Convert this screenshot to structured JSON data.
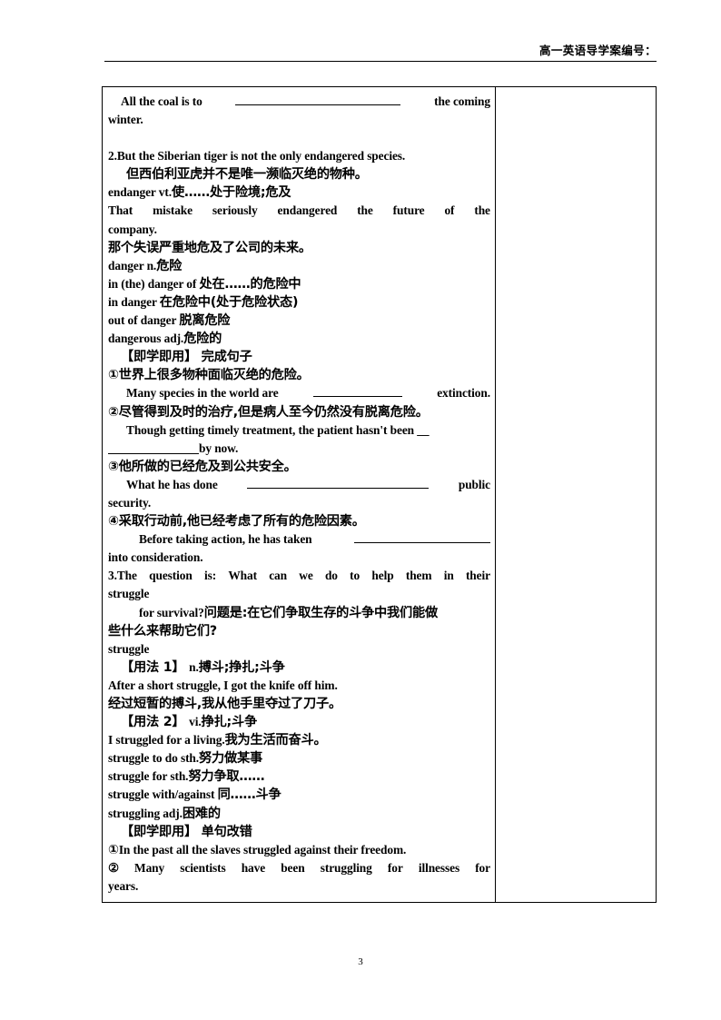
{
  "header": {
    "title": "高一英语导学案编号："
  },
  "page": {
    "number": "3"
  },
  "content": {
    "l1a": "All  the  coal  is  to",
    "l1b": "the  coming",
    "l2": "winter.",
    "l3": "2.But the Siberian tiger is not the only endangered species.",
    "l4": "但西伯利亚虎并不是唯一濒临灭绝的物种。",
    "l5_en": "endanger vt.",
    "l5_cn": "使……处于险境;危及",
    "l6a": "That",
    "l6b": "mistake",
    "l6c": "seriously",
    "l6d": "endangered",
    "l6e": "the",
    "l6f": "future",
    "l6g": "of",
    "l6h": "the",
    "l7": "company.",
    "l8": "那个失误严重地危及了公司的未来。",
    "l9_en": "danger n.",
    "l9_cn": "危险",
    "l10_en": "in (the) danger of ",
    "l10_cn": "处在……的危险中",
    "l11_en": "in danger  ",
    "l11_cn": "在危险中(处于危险状态)",
    "l12_en": "out of danger  ",
    "l12_cn": "脱离危险",
    "l13_en": "dangerous adj.",
    "l13_cn": "危险的",
    "l14": "【即学即用】 完成句子",
    "l15": "①世界上很多物种面临灭绝的危险。",
    "l16a": "Many species in the world are",
    "l16b": "extinction.",
    "l17": "②尽管得到及时的治疗,但是病人至今仍然没有脱离危险。",
    "l18": "Though getting timely treatment, the patient hasn't been __",
    "l19": "by now.",
    "l20": "③他所做的已经危及到公共安全。",
    "l21a": "What  he  has  done",
    "l21b": "public",
    "l22": "security.",
    "l23": "④采取行动前,他已经考虑了所有的危险因素。",
    "l24": "Before taking action, he has taken",
    "l25": "into consideration.",
    "l26a": "3.The",
    "l26b": "question",
    "l26c": "is:",
    "l26d": "What",
    "l26e": "can",
    "l26f": "we",
    "l26g": "do",
    "l26h": "to",
    "l26i": "help",
    "l26j": "them",
    "l26k": "in",
    "l26l": "their",
    "l27": "struggle",
    "l28_en": "for  survival?",
    "l28_cn": "问题是:在它们争取生存的斗争中我们能做",
    "l29": "些什么来帮助它们?",
    "l30": "struggle",
    "l31_cn": "【用法 1】 ",
    "l31_en": "n.",
    "l31_cn2": "搏斗;挣扎;斗争",
    "l32": "After a short struggle, I got the knife off him.",
    "l33": "经过短暂的搏斗,我从他手里夺过了刀子。",
    "l34_cn": "【用法 2】 ",
    "l34_en": "vi.",
    "l34_cn2": "挣扎;斗争",
    "l35_en": "I struggled for a living.",
    "l35_cn": "我为生活而奋斗。",
    "l36_en": "struggle to do sth.",
    "l36_cn": "努力做某事",
    "l37_en": "struggle for sth.",
    "l37_cn": "努力争取……",
    "l38_en": "struggle with/against  ",
    "l38_cn": "同……斗争",
    "l39_en": "struggling adj.",
    "l39_cn": "困难的",
    "l40": "【即学即用】 单句改错",
    "l41_num": "①",
    "l41_en": "In the past all the slaves struggled against their freedom.",
    "l42_num": "②",
    "l42a": "Many",
    "l42b": "scientists",
    "l42c": "have",
    "l42d": "been",
    "l42e": "struggling",
    "l42f": "for",
    "l42g": "illnesses",
    "l42h": "for",
    "l43": "years."
  }
}
